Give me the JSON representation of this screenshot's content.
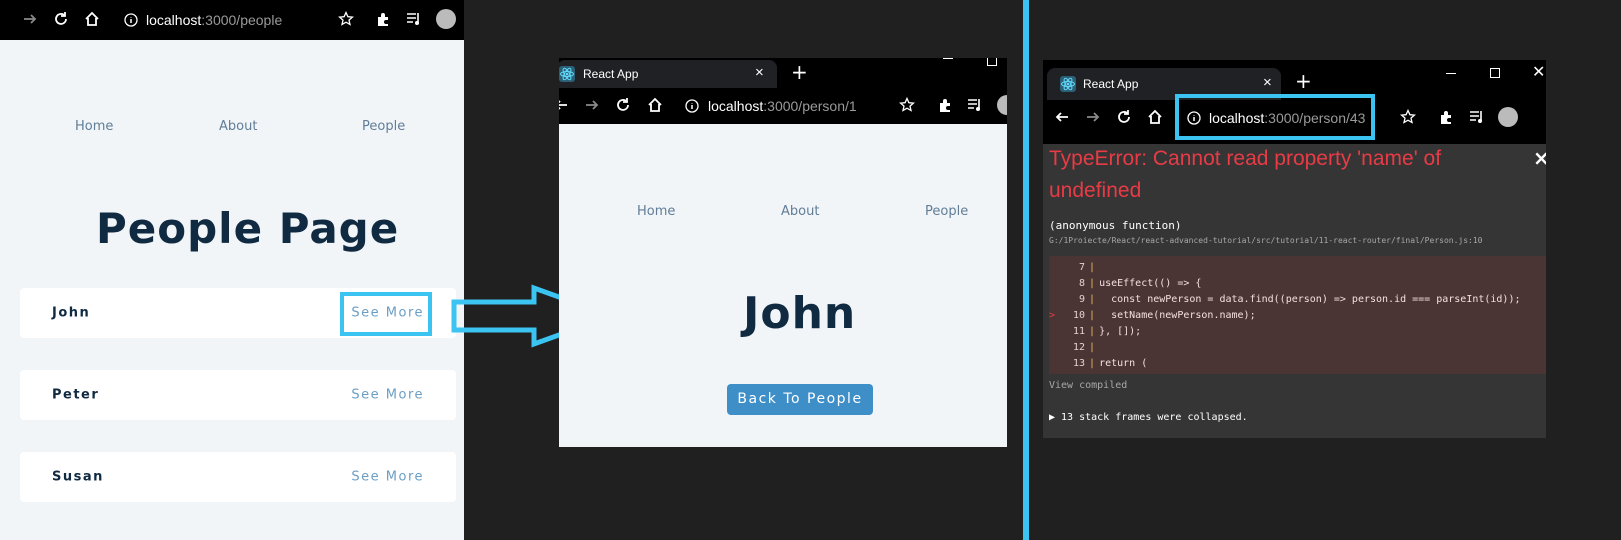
{
  "panel_people": {
    "url_host": "localhost",
    "url_path": ":3000/people",
    "nav": [
      "Home",
      "About",
      "People"
    ],
    "title": "People Page",
    "people": [
      {
        "name": "John",
        "link": "See More"
      },
      {
        "name": "Peter",
        "link": "See More"
      },
      {
        "name": "Susan",
        "link": "See More"
      }
    ]
  },
  "panel_person": {
    "tab_title": "React App",
    "url_host": "localhost",
    "url_path": ":3000/person/1",
    "nav": [
      "Home",
      "About",
      "People"
    ],
    "title": "John",
    "back_button": "Back To People"
  },
  "panel_error": {
    "tab_title": "React App",
    "url_host": "localhost",
    "url_path": ":3000/person/43",
    "error_line1": "TypeError: Cannot read property 'name' of",
    "error_line2": "undefined",
    "close": "×",
    "fn_name": "(anonymous function)",
    "file_path": "G:/1Proiecte/React/react-advanced-tutorial/src/tutorial/11-react-router/final/Person.js:10",
    "code": [
      {
        "n": "7",
        "text": ""
      },
      {
        "n": "8",
        "text": "useEffect(() => {"
      },
      {
        "n": "9",
        "text": "  const newPerson = data.find((person) => person.id === parseInt(id));"
      },
      {
        "n": "10",
        "text": "  setName(newPerson.name);"
      },
      {
        "n": "11",
        "text": "}, []);"
      },
      {
        "n": "12",
        "text": ""
      },
      {
        "n": "13",
        "text": "return ("
      }
    ],
    "view_compiled": "View compiled",
    "collapsed": "▶ 13 stack frames were collapsed."
  },
  "colors": {
    "highlight": "#3bc4f2",
    "error_red": "#e83b46",
    "heading": "#102a42",
    "link": "#6a9ec4",
    "button": "#3e8ec8"
  },
  "icons": [
    "forward-arrow-icon",
    "back-arrow-icon",
    "reload-icon",
    "home-icon",
    "info-icon",
    "star-icon",
    "extensions-icon",
    "media-icon",
    "avatar-icon",
    "react-logo-icon",
    "close-tab-icon",
    "new-tab-icon",
    "minimize-icon",
    "maximize-icon",
    "close-window-icon",
    "right-arrow-icon"
  ]
}
